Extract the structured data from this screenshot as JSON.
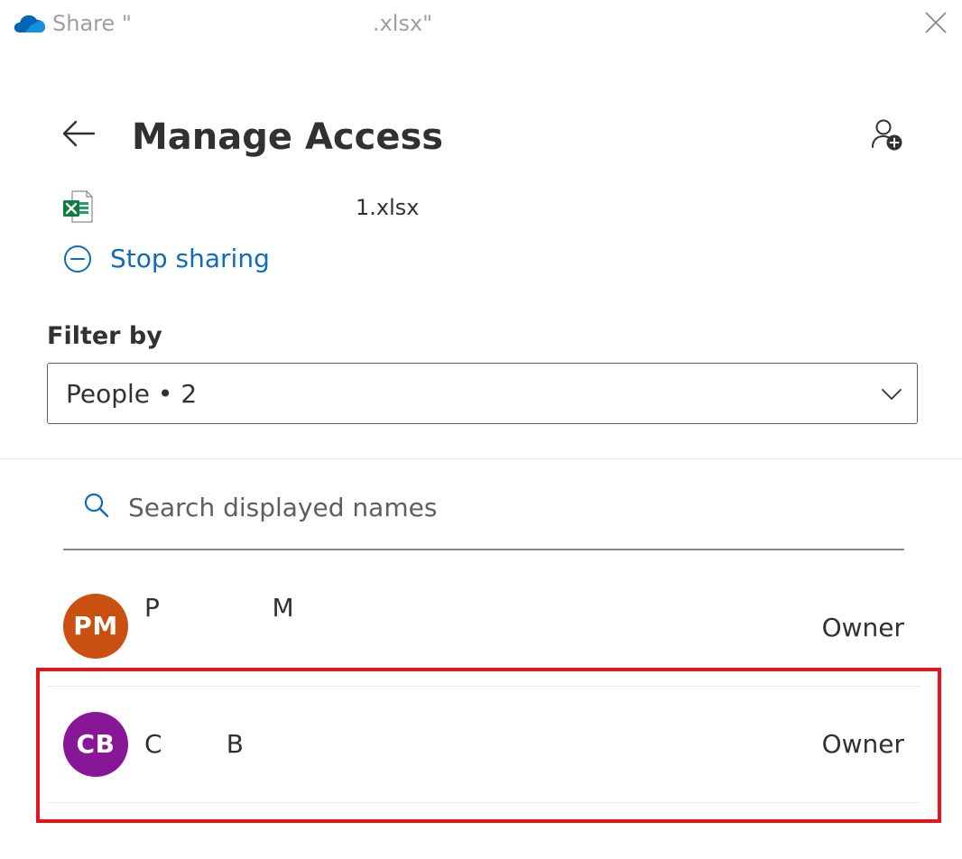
{
  "window": {
    "title": "Share \"                                   .xlsx\"",
    "icon": "onedrive-cloud-icon",
    "close_icon": "close-icon"
  },
  "header": {
    "title": "Manage Access",
    "back_icon": "back-arrow-icon",
    "add_icon": "add-person-icon"
  },
  "file": {
    "icon": "excel-file-icon",
    "name": "1.xlsx"
  },
  "stop_sharing": {
    "label": "Stop sharing",
    "icon": "minus-circle-icon"
  },
  "filter": {
    "label": "Filter by",
    "selected": "People • 2",
    "icon": "chevron-down-icon"
  },
  "search": {
    "placeholder": "Search displayed names",
    "value": "",
    "icon": "search-icon"
  },
  "people": [
    {
      "initials": "PM",
      "name": "P              M",
      "role": "Owner",
      "avatar_color": "#ca5010"
    },
    {
      "initials": "CB",
      "name": "C        B",
      "role": "Owner",
      "avatar_color": "#881798"
    }
  ],
  "colors": {
    "accent": "#0f6cbd",
    "highlight": "#e4161c",
    "title_text": "#323130",
    "muted_text": "#a19f9d"
  }
}
